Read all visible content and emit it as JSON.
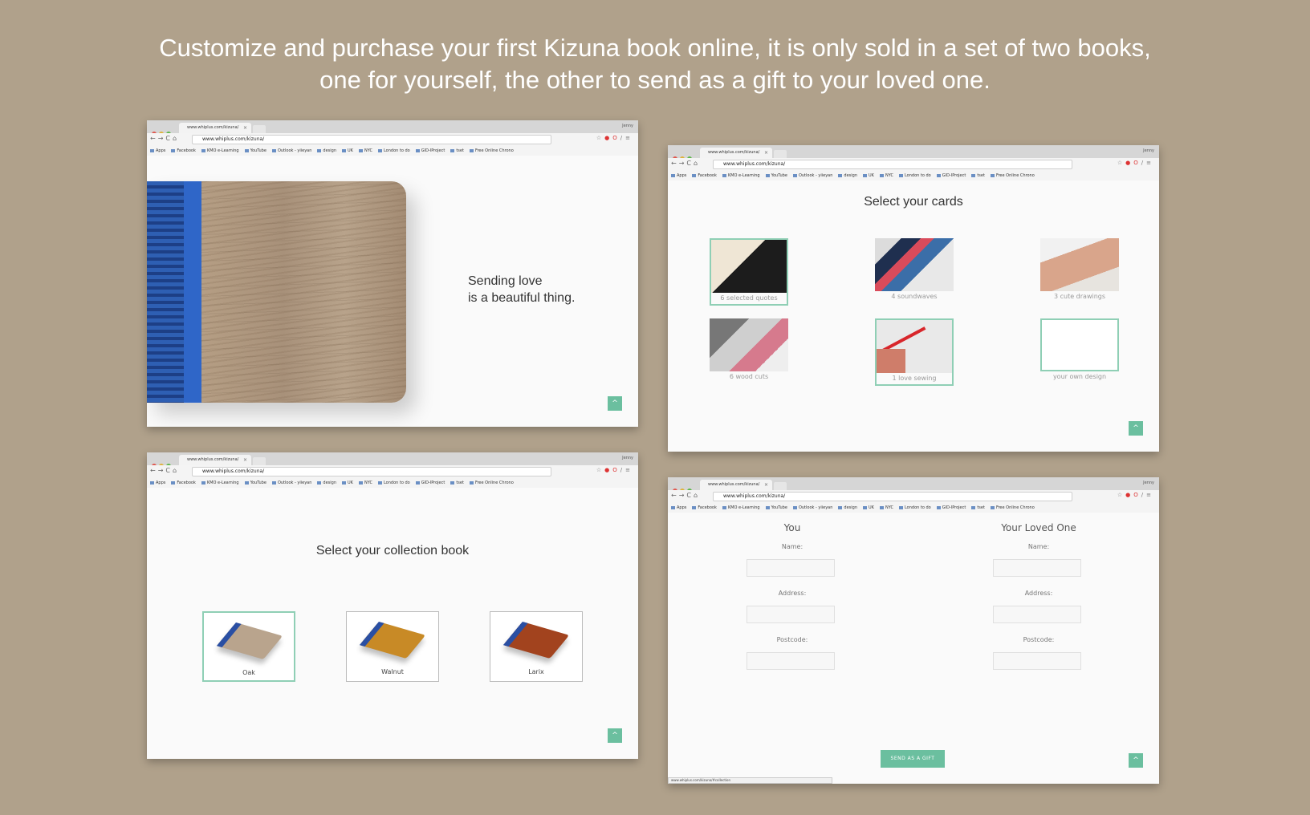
{
  "headline": {
    "line1": "Customize and purchase your first Kizuna book online, it is only sold in a set of two books,",
    "line2": "one for yourself, the other to send as a gift to your loved one."
  },
  "browser": {
    "tab_title": "www.whiplus.com/kizuna/",
    "tab_close": "×",
    "user": "Jenny",
    "url": "www.whiplus.com/kizuna/",
    "bookmarks": [
      "Apps",
      "Facebook",
      "KMO e-Learning",
      "YouTube",
      "Outlook - yiieyan",
      "design",
      "UK",
      "NYC",
      "London to do",
      "GID-IProject",
      "tset",
      "Free Online Chrono"
    ]
  },
  "hero": {
    "tagline_line1": "Sending love",
    "tagline_line2": "is a beautiful thing."
  },
  "cards": {
    "title": "Select your cards",
    "items": [
      {
        "label": "6 selected quotes",
        "selected": true
      },
      {
        "label": "4 soundwaves",
        "selected": false
      },
      {
        "label": "3 cute drawings",
        "selected": false
      },
      {
        "label": "6 wood cuts",
        "selected": false
      },
      {
        "label": "1 love sewing",
        "selected": true
      },
      {
        "label": "your own design",
        "selected": false
      }
    ]
  },
  "collection": {
    "title": "Select your collection book",
    "items": [
      {
        "label": "Oak",
        "selected": true
      },
      {
        "label": "Walnut",
        "selected": false
      },
      {
        "label": "Larix",
        "selected": false
      }
    ]
  },
  "form": {
    "you": {
      "title": "You",
      "name_label": "Name:",
      "address_label": "Address:",
      "postcode_label": "Postcode:"
    },
    "loved_one": {
      "title": "Your Loved One",
      "name_label": "Name:",
      "address_label": "Address:",
      "postcode_label": "Postcode:"
    },
    "button": "SEND AS A GIFT",
    "status_url": "www.whiplus.com/kizuna/#collection"
  },
  "icons": {
    "scroll_top": "^"
  },
  "colors": {
    "background": "#b0a18b",
    "accent": "#6bbf9f",
    "selected_border": "#8fcfb5"
  }
}
